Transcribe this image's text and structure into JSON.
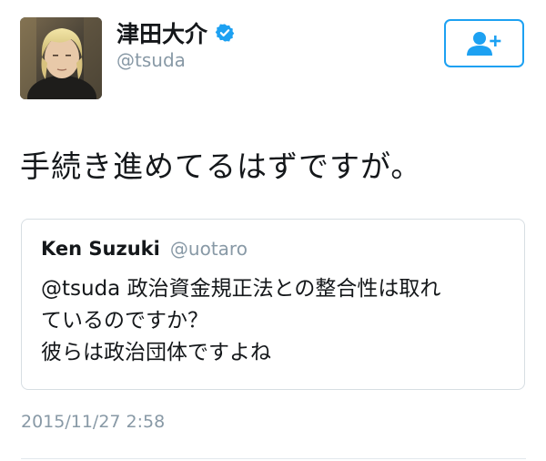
{
  "author": {
    "display_name": "津田大介",
    "handle": "@tsuda",
    "verified": true
  },
  "follow_button": {
    "icon": "add-user-icon",
    "color": "#1da1f2"
  },
  "tweet": {
    "text": "手続き進めてるはずですが。",
    "timestamp": "2015/11/27 2:58"
  },
  "quoted_tweet": {
    "author_name": "Ken Suzuki",
    "author_handle": "@uotaro",
    "lines": [
      "@tsuda 政治資金規正法との整合性は取れ",
      "ているのですか？",
      "彼らは政治団体ですよね"
    ]
  },
  "colors": {
    "accent": "#1da1f2",
    "text": "#14171a",
    "secondary": "#8899a6",
    "border": "#d7dee3"
  }
}
